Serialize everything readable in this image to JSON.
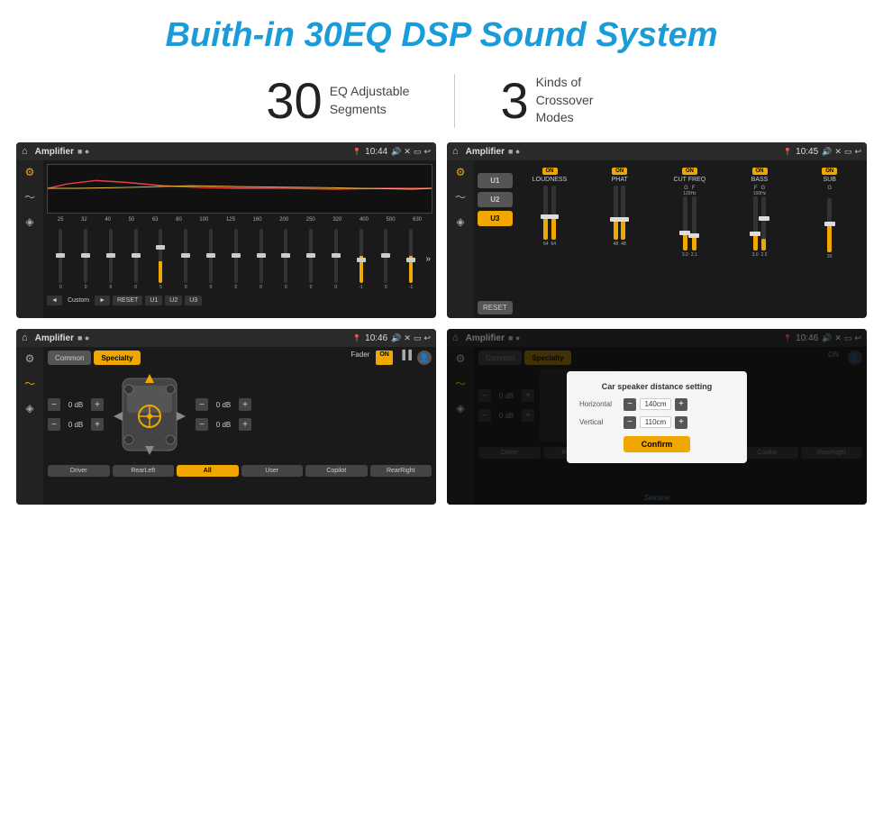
{
  "page": {
    "title": "Buith-in 30EQ DSP Sound System"
  },
  "stats": [
    {
      "number": "30",
      "label": "EQ Adjustable\nSegments"
    },
    {
      "number": "3",
      "label": "Kinds of\nCrossover Modes"
    }
  ],
  "screens": {
    "eq": {
      "app_name": "Amplifier",
      "time": "10:44",
      "freq_labels": [
        "25",
        "32",
        "40",
        "50",
        "63",
        "80",
        "100",
        "125",
        "160",
        "200",
        "250",
        "320",
        "400",
        "500",
        "630"
      ],
      "slider_values": [
        "0",
        "0",
        "0",
        "0",
        "5",
        "0",
        "0",
        "0",
        "0",
        "0",
        "0",
        "0",
        "-1",
        "0",
        "-1"
      ],
      "buttons": [
        "◄",
        "Custom",
        "►",
        "RESET",
        "U1",
        "U2",
        "U3"
      ]
    },
    "crossover": {
      "app_name": "Amplifier",
      "time": "10:45",
      "presets": [
        "U1",
        "U2",
        "U3"
      ],
      "active_preset": "U3",
      "channels": [
        {
          "name": "LOUDNESS",
          "on": true
        },
        {
          "name": "PHAT",
          "on": true
        },
        {
          "name": "CUT FREQ",
          "on": true
        },
        {
          "name": "BASS",
          "on": true
        },
        {
          "name": "SUB",
          "on": true
        }
      ]
    },
    "fader": {
      "app_name": "Amplifier",
      "time": "10:46",
      "tabs": [
        "Common",
        "Specialty"
      ],
      "active_tab": "Specialty",
      "fader_label": "Fader",
      "fader_on": "ON",
      "volumes": [
        "0 dB",
        "0 dB",
        "0 dB",
        "0 dB"
      ],
      "bottom_buttons": [
        "Driver",
        "RearLeft",
        "All",
        "User",
        "Copilot",
        "RearRight"
      ]
    },
    "distance": {
      "app_name": "Amplifier",
      "time": "10:46",
      "tabs": [
        "Common",
        "Specialty"
      ],
      "active_tab": "Specialty",
      "dialog": {
        "title": "Car speaker distance setting",
        "horizontal_label": "Horizontal",
        "horizontal_value": "140cm",
        "vertical_label": "Vertical",
        "vertical_value": "110cm",
        "confirm_label": "Confirm"
      },
      "volumes": [
        "0 dB",
        "0 dB"
      ],
      "bottom_buttons": [
        "Driver",
        "RearLeft",
        "All",
        "User",
        "Copilot",
        "RearRight"
      ]
    }
  },
  "watermark": "Seicane"
}
